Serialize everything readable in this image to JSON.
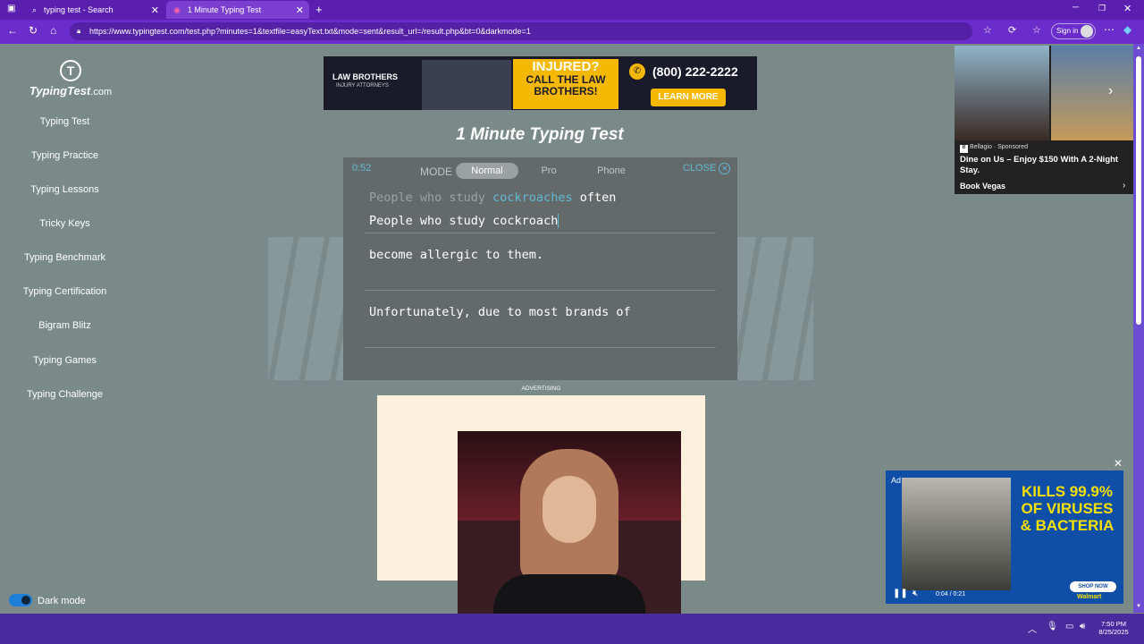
{
  "tabs": [
    {
      "label": "typing test - Search"
    },
    {
      "label": "1 Minute Typing Test"
    }
  ],
  "url": "https://www.typingtest.com/test.php?minutes=1&textfile=easyText.txt&mode=sent&result_url=/result.php&bt=0&darkmode=1",
  "sign_in": "Sign in",
  "logo": {
    "name": "TypingTest",
    "domain": ".com"
  },
  "nav": [
    "Typing Test",
    "Typing Practice",
    "Typing Lessons",
    "Tricky Keys",
    "Typing Benchmark",
    "Typing Certification",
    "Bigram Blitz",
    "Typing Games",
    "Typing Challenge"
  ],
  "dark_mode": "Dark mode",
  "banner": {
    "brand": "LAW BROTHERS",
    "brand_sub": "INJURY ATTORNEYS",
    "injured": "INJURED?",
    "call": "CALL THE LAW BROTHERS!",
    "phone": "(800) 222-2222",
    "cta": "LEARN MORE"
  },
  "page_title": "1 Minute Typing Test",
  "test": {
    "timer": "0:52",
    "mode_label": "MODE",
    "modes": [
      "Normal",
      "Pro",
      "Phone"
    ],
    "close": "CLOSE",
    "line1_typed": "People who study ",
    "line1_current": "cockroaches",
    "line1_rest": " often",
    "input": "People who study cockroach",
    "line2": "become allergic to them.",
    "line3": "Unfortunately, due to most brands of"
  },
  "right_ad": {
    "brand": "Bellagio",
    "sponsored": "· Sponsored",
    "headline": "Dine on Us – Enjoy $150 With A 2-Night Stay.",
    "cta": "Book Vegas"
  },
  "advertising": "ADVERTISING",
  "video_ad": {
    "tag": "Ad",
    "headline": "KILLS 99.9% OF VIRUSES & BACTERIA",
    "cta": "SHOP NOW",
    "brand": "Walmart",
    "time": "0:04 / 0:21"
  },
  "clock": {
    "time": "7:50 PM",
    "date": "8/25/2025"
  },
  "colors": {
    "accent": "#5fb8d4",
    "purple": "#5b1fb0"
  }
}
